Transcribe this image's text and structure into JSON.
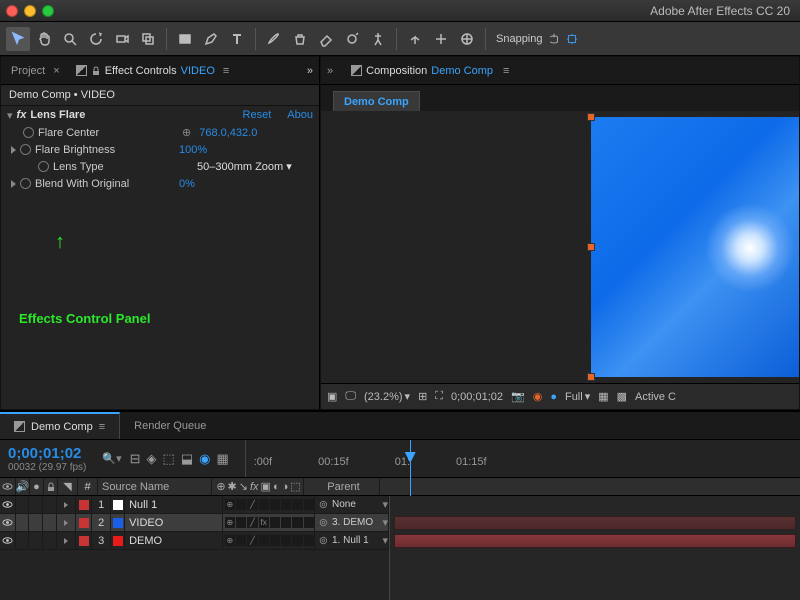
{
  "app_title": "Adobe After Effects CC 20",
  "snapping_label": "Snapping",
  "panels": {
    "project_tab": "Project",
    "effect_controls_label": "Effect Controls",
    "effect_controls_target": "VIDEO",
    "crumb": "Demo Comp • VIDEO",
    "fx": {
      "name": "Lens Flare",
      "reset": "Reset",
      "about": "Abou",
      "props": [
        {
          "label": "Flare Center",
          "value": "768.0,432.0"
        },
        {
          "label": "Flare Brightness",
          "value": "100%"
        },
        {
          "label": "Lens Type",
          "value": "50–300mm Zoom ▾"
        },
        {
          "label": "Blend With Original",
          "value": "0%"
        }
      ]
    },
    "annotation": "Effects Control Panel"
  },
  "composition": {
    "tab_label": "Composition",
    "tab_name": "Demo Comp",
    "subtab": "Demo Comp"
  },
  "viewer_bar": {
    "zoom": "(23.2%)",
    "timecode": "0;00;01;02",
    "res": "Full",
    "view": "Active C"
  },
  "timeline": {
    "tab_active": "Demo Comp",
    "tab_other": "Render Queue",
    "timecode": "0;00;01;02",
    "timecode_sub": "00032 (29.97 fps)",
    "ruler": [
      ":00f",
      "00:15f",
      "01:",
      "01:15f"
    ],
    "header": {
      "num": "#",
      "source": "Source Name",
      "parent": "Parent"
    },
    "layers": [
      {
        "num": "1",
        "color": "#fff",
        "name": "Null 1",
        "parent": "None",
        "fx": ""
      },
      {
        "num": "2",
        "color": "#1b5ee8",
        "name": "VIDEO",
        "parent": "3. DEMO",
        "fx": "fx"
      },
      {
        "num": "3",
        "color": "#e81b1b",
        "name": "DEMO",
        "parent": "1. Null 1",
        "fx": ""
      }
    ]
  }
}
